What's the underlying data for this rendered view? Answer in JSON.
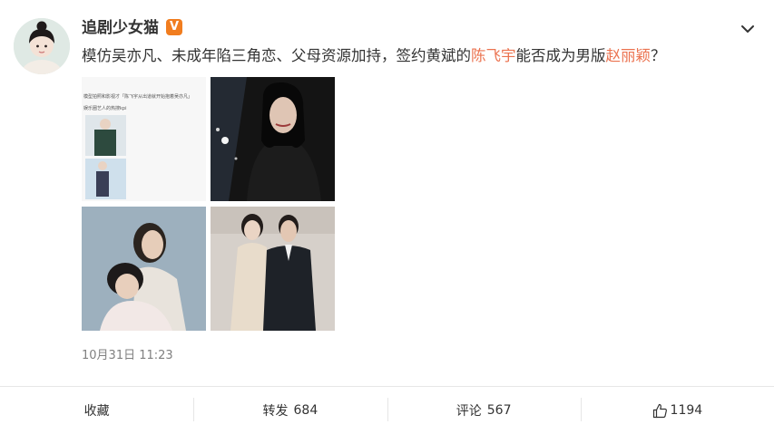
{
  "user": {
    "name": "追剧少女猫",
    "verified_badge": "V",
    "badge_color": "#f17d1f"
  },
  "post": {
    "text_parts": [
      "模仿吴亦凡、未成年陷三角恋、父母资源加持，签约黄斌的",
      "陈飞宇",
      "能否成为男版",
      "赵丽颖",
      "？"
    ],
    "highlight_color": "#eb7350",
    "images": [
      {
        "icon": "screenshot-collage-image",
        "overlay_text": "模型拍照和影视才「陈飞宇从出道就开始抱着吴亦凡」",
        "overlay_text_2": "娱乐圈艺人的热搜kpi"
      },
      {
        "icon": "portrait-night-image"
      },
      {
        "icon": "couple-photoshoot-image"
      },
      {
        "icon": "couple-event-image"
      }
    ],
    "timestamp": "10月31日 11:23"
  },
  "actions": {
    "favorite": "收藏",
    "repost_label": "转发",
    "repost_count": "684",
    "comment_label": "评论",
    "comment_count": "567",
    "like_count": "1194"
  },
  "icons": {
    "expand": "chevron-down-icon",
    "like": "thumbs-up-icon"
  }
}
